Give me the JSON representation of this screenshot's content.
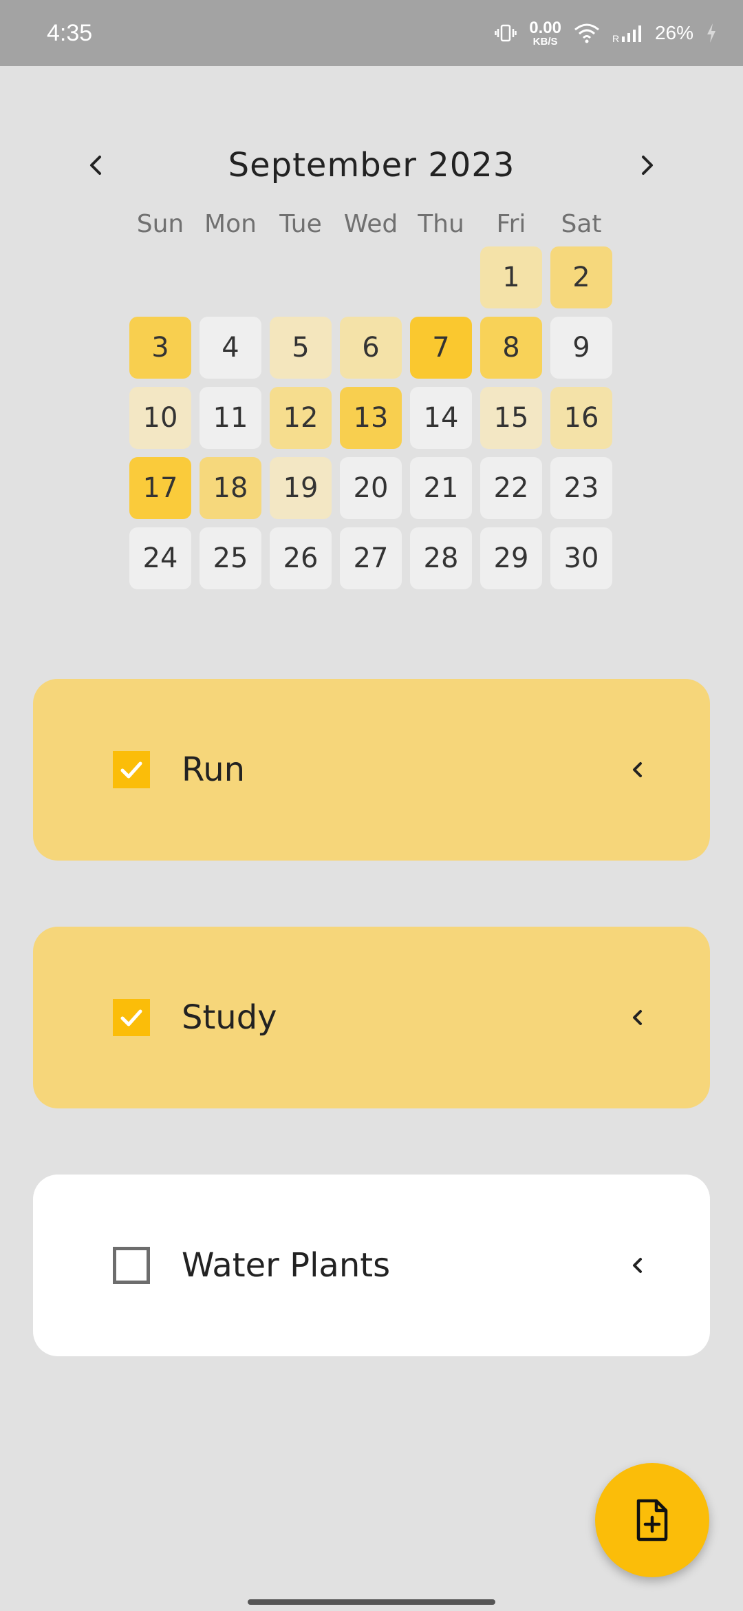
{
  "status_bar": {
    "time": "4:35",
    "net_value": "0.00",
    "net_unit": "KB/S",
    "battery": "26%"
  },
  "calendar": {
    "month_title": "September 2023",
    "weekdays": [
      "Sun",
      "Mon",
      "Tue",
      "Wed",
      "Thu",
      "Fri",
      "Sat"
    ],
    "leading_blanks": 5,
    "days": [
      {
        "n": "1",
        "color": "#f4e2a8"
      },
      {
        "n": "2",
        "color": "#f6d87c"
      },
      {
        "n": "3",
        "color": "#f8cf4f"
      },
      {
        "n": "4",
        "color": "#efefef"
      },
      {
        "n": "5",
        "color": "#f4e6bd"
      },
      {
        "n": "6",
        "color": "#f4e2a8"
      },
      {
        "n": "7",
        "color": "#fac82f"
      },
      {
        "n": "8",
        "color": "#f8d258"
      },
      {
        "n": "9",
        "color": "#efefef"
      },
      {
        "n": "10",
        "color": "#f3e7c4"
      },
      {
        "n": "11",
        "color": "#efefef"
      },
      {
        "n": "12",
        "color": "#f6dd8e"
      },
      {
        "n": "13",
        "color": "#f8cf4f"
      },
      {
        "n": "14",
        "color": "#efefef"
      },
      {
        "n": "15",
        "color": "#f3e7c4"
      },
      {
        "n": "16",
        "color": "#f4e2a8"
      },
      {
        "n": "17",
        "color": "#facb3b"
      },
      {
        "n": "18",
        "color": "#f6d87c"
      },
      {
        "n": "19",
        "color": "#f3e7c4"
      },
      {
        "n": "20",
        "color": "#efefef"
      },
      {
        "n": "21",
        "color": "#efefef"
      },
      {
        "n": "22",
        "color": "#efefef"
      },
      {
        "n": "23",
        "color": "#efefef"
      },
      {
        "n": "24",
        "color": "#efefef"
      },
      {
        "n": "25",
        "color": "#efefef"
      },
      {
        "n": "26",
        "color": "#efefef"
      },
      {
        "n": "27",
        "color": "#efefef"
      },
      {
        "n": "28",
        "color": "#efefef"
      },
      {
        "n": "29",
        "color": "#efefef"
      },
      {
        "n": "30",
        "color": "#efefef"
      }
    ]
  },
  "tasks": [
    {
      "label": "Run",
      "checked": true,
      "bg": "#f6d67a"
    },
    {
      "label": "Study",
      "checked": true,
      "bg": "#f6d67a"
    },
    {
      "label": "Water Plants",
      "checked": false,
      "bg": "#ffffff"
    }
  ],
  "icons": {
    "prev": "chevron-left-icon",
    "next": "chevron-right-icon",
    "expand": "chevron-left-icon",
    "fab": "add-note-icon"
  },
  "colors": {
    "accent": "#fbbd09",
    "background": "#e1e1e1",
    "status_bar": "#a3a3a3"
  }
}
